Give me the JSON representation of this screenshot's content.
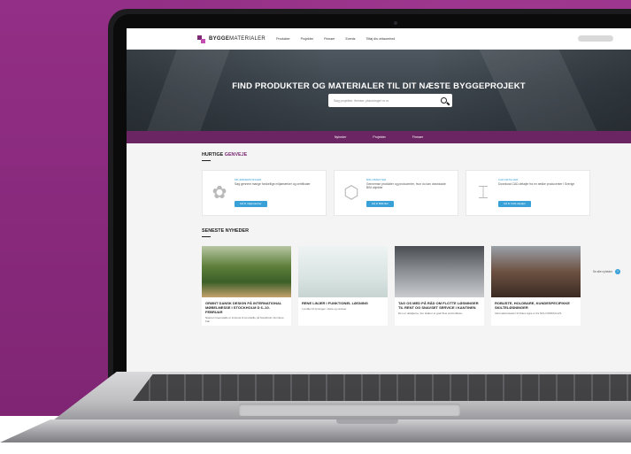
{
  "colors": {
    "background": "#8a2a7c",
    "brand": "#7b2a73",
    "subnav": "#6b2563",
    "accent": "#3aa0d8"
  },
  "nav": {
    "logo_bold": "BYGGE",
    "logo_light": "MATERIALER",
    "items": [
      "Produkter",
      "Projekter",
      "Firmaer",
      "Events",
      "Tilføj din virksomhed"
    ]
  },
  "hero": {
    "title": "FIND PRODUKTER OG MATERIALER TIL DIT NÆSTE BYGGEPROJEKT",
    "search_placeholder": "Søg projekter, firmaer, placeringer m.m."
  },
  "subnav": {
    "items": [
      "Nyheder",
      "Projekter",
      "Firmaer"
    ]
  },
  "shortcuts": {
    "title_prefix": "HURTIGE",
    "title_highlight": "GENVEJE",
    "cards": [
      {
        "icon": "flower-icon",
        "label": "Miljømærkninger",
        "text": "Søg gennem mange forskellige miljømærker og certificater",
        "button": "Gå til miljømærker"
      },
      {
        "icon": "cube-icon",
        "label": "BIM-objekter",
        "text": "Gennemse produkter og producenter, hvor du kan downloade BIM objekter",
        "button": "Gå til BIM-filer"
      },
      {
        "icon": "cad-icon",
        "label": "CAD-detaljer",
        "text": "Download CAD-detaljer fra en række producenter i Sverige",
        "button": "Gå til CAD-detaljer"
      }
    ]
  },
  "news": {
    "title": "SENESTE NYHEDER",
    "see_all": "Se alle nyheder",
    "cards": [
      {
        "title": "GRØNT DANSK DESIGN PÅ INTERNATIONAL MØBELMESSE I STOCKHOLM D 6.-10. FEBRUAR",
        "text": "Naturel Greenwalls er inviteret til at udstille på Stockholm Furniture Fair"
      },
      {
        "title": "RENE LINJER I FUNKTIONEL LØSNING",
        "text": "I profiler til fyrningen i døre og vinduer"
      },
      {
        "title": "TAG OS MED PÅ RÅD OM FLOTTE LØSNINGER TIL RENT OG SNAVSET SERVICE I KANTINEN",
        "text": "Den er detaljerne, der skaber et godt flow ved buffeten"
      },
      {
        "title": "ROBUSTE, HOLDBARE, KUNDESPECIFIKKE SKILTELØSNINGER",
        "text": "Informationstavler til Rolex Agra er fra NCH ORRICA A/S"
      }
    ]
  }
}
